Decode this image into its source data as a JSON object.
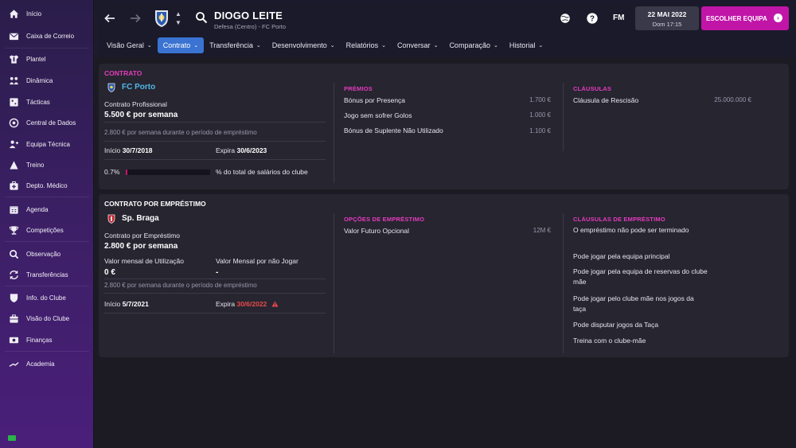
{
  "sidebar": {
    "items": [
      {
        "label": "Início",
        "icon": "home-icon"
      },
      {
        "label": "Caixa de Correio",
        "icon": "inbox-icon"
      },
      {
        "label": "Plantel",
        "icon": "shirt-icon"
      },
      {
        "label": "Dinâmica",
        "icon": "dynamics-icon"
      },
      {
        "label": "Tácticas",
        "icon": "tactics-icon"
      },
      {
        "label": "Central de Dados",
        "icon": "data-hub-icon"
      },
      {
        "label": "Equipa Técnica",
        "icon": "staff-icon"
      },
      {
        "label": "Treino",
        "icon": "training-icon"
      },
      {
        "label": "Depto. Médico",
        "icon": "medical-icon"
      },
      {
        "label": "Agenda",
        "icon": "calendar-icon"
      },
      {
        "label": "Competições",
        "icon": "trophy-icon"
      },
      {
        "label": "Observação",
        "icon": "scouting-icon"
      },
      {
        "label": "Transferências",
        "icon": "transfers-icon"
      },
      {
        "label": "Info. do Clube",
        "icon": "club-info-icon"
      },
      {
        "label": "Visão do Clube",
        "icon": "club-vision-icon"
      },
      {
        "label": "Finanças",
        "icon": "finances-icon"
      },
      {
        "label": "Academia",
        "icon": "academy-icon"
      }
    ]
  },
  "header": {
    "player_name": "DIOGO LEITE",
    "player_subtitle": "Defesa (Centro) - FC Porto",
    "fm_logo": "FM",
    "date": "22 MAI 2022",
    "time": "Dom 17:15",
    "choose_team": "ESCOLHER EQUIPA",
    "tabs": [
      {
        "label": "Visão Geral",
        "active": false
      },
      {
        "label": "Contrato",
        "active": true
      },
      {
        "label": "Transferência",
        "active": false
      },
      {
        "label": "Desenvolvimento",
        "active": false
      },
      {
        "label": "Relatórios",
        "active": false
      },
      {
        "label": "Conversar",
        "active": false
      },
      {
        "label": "Comparação",
        "active": false
      },
      {
        "label": "Historial",
        "active": false
      }
    ]
  },
  "contract": {
    "title": "CONTRATO",
    "club": "FC Porto",
    "type": "Contrato Profissional",
    "wage": "5.500 € por semana",
    "loan_note": "2.800 € por semana durante o período de empréstimo",
    "start_label": "Início",
    "start": "30/7/2018",
    "expires_label": "Expira",
    "expires": "30/6/2023",
    "wage_pct": "0.7%",
    "wage_pct_value": 0.7,
    "wage_pct_label": "% do total de salários do clube",
    "bonuses_title": "PRÉMIOS",
    "bonuses": [
      {
        "label": "Bónus por Presença",
        "value": "1.700 €"
      },
      {
        "label": "Jogo sem sofrer Golos",
        "value": "1.000 €"
      },
      {
        "label": "Bónus de Suplente Não Utilizado",
        "value": "1.100 €"
      }
    ],
    "clauses_title": "CLÁUSULAS",
    "clauses": [
      {
        "label": "Cláusula de Rescisão",
        "value": "25.000.000 €"
      }
    ]
  },
  "loan": {
    "title": "CONTRATO POR EMPRÉSTIMO",
    "club": "Sp. Braga",
    "type": "Contrato por Empréstimo",
    "wage": "2.800 € por semana",
    "monthly_fee_label": "Valor mensal de Utilização",
    "monthly_fee": "0 €",
    "not_playing_label": "Valor Mensal por não Jogar",
    "not_playing": "-",
    "loan_note": "2.800 € por semana durante o período de empréstimo",
    "start_label": "Início",
    "start": "5/7/2021",
    "expires_label": "Expira",
    "expires": "30/6/2022",
    "options_title": "OPÇÕES DE EMPRÉSTIMO",
    "options": [
      {
        "label": "Valor Futuro Opcional",
        "value": "12M €"
      }
    ],
    "clauses_title": "CLÁUSULAS DE EMPRÉSTIMO",
    "clauses": [
      "O empréstimo não pode ser terminado",
      "Pode jogar pela equipa principal",
      "Pode jogar pela equipa de reservas do clube mãe",
      "Pode jogar pelo clube mãe nos jogos da taça",
      "Pode disputar jogos da Taça",
      "Treina com o clube-mãe"
    ]
  },
  "colors": {
    "accent_magenta": "#e53bbd",
    "porto_blue": "#4fb8e8",
    "tab_active": "#3a73d2",
    "choose_team_bg": "#c115a8",
    "warning_red": "#e84a4a"
  }
}
